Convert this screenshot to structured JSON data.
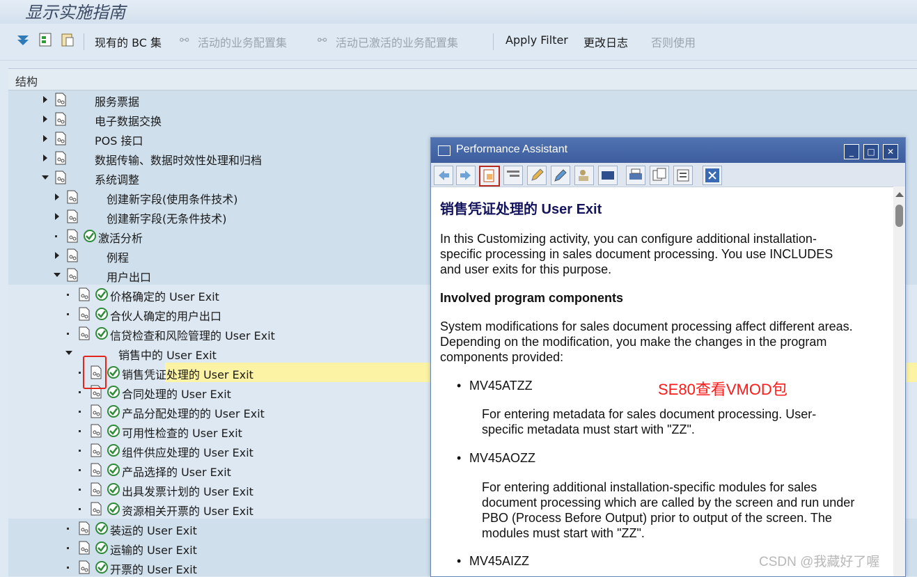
{
  "window": {
    "title": "显示实施指南"
  },
  "toolbar": {
    "items": [
      {
        "label": "现有的 BC 集",
        "enabled": true
      },
      {
        "label": "活动的业务配置集",
        "enabled": false
      },
      {
        "label": "活动已激活的业务配置集",
        "enabled": false
      },
      {
        "label": "Apply Filter",
        "enabled": true
      },
      {
        "label": "更改日志",
        "enabled": true
      },
      {
        "label": "否则使用",
        "enabled": false
      }
    ]
  },
  "tree": {
    "header": "结构",
    "nodes": [
      {
        "label": "服务票据"
      },
      {
        "label": "电子数据交换"
      },
      {
        "label": "POS 接口"
      },
      {
        "label": "数据传输、数据时效性处理和归档"
      },
      {
        "label": "系统调整"
      },
      {
        "label": "创建新字段(使用条件技术)"
      },
      {
        "label": "创建新字段(无条件技术)"
      },
      {
        "label": "激活分析"
      },
      {
        "label": "例程"
      },
      {
        "label": "用户出口"
      },
      {
        "label": "价格确定的 User Exit"
      },
      {
        "label": "合伙人确定的用户出口"
      },
      {
        "label": "信贷检查和风险管理的 User Exit"
      },
      {
        "label": "销售中的 User Exit"
      },
      {
        "label": "销售凭证处理的 User Exit"
      },
      {
        "label": "合同处理的 User Exit"
      },
      {
        "label": "产品分配处理的的 User Exit"
      },
      {
        "label": "可用性检查的 User Exit"
      },
      {
        "label": "组件供应处理的 User Exit"
      },
      {
        "label": "产品选择的 User Exit"
      },
      {
        "label": "出具发票计划的 User Exit"
      },
      {
        "label": "资源相关开票的 User Exit"
      },
      {
        "label": "装运的 User Exit"
      },
      {
        "label": "运输的 User Exit"
      },
      {
        "label": "开票的 User Exit"
      }
    ]
  },
  "assistant": {
    "title": "Performance Assistant",
    "heading": "销售凭证处理的 User Exit",
    "intro_lines": [
      "In this Customizing activity, you can configure additional installation-",
      "specific processing in sales document processing. You use INCLUDES",
      "and user exits for this purpose."
    ],
    "section_title": "Involved program components",
    "section_lines": [
      "System modifications for sales document processing affect different areas.",
      "Depending on the modification, you make the changes in the program",
      "components provided:"
    ],
    "components": [
      {
        "name": "MV45ATZZ",
        "desc_lines": [
          "For entering metadata for sales document processing. User-",
          "specific metadata must start with \"ZZ\"."
        ]
      },
      {
        "name": "MV45AOZZ",
        "desc_lines": [
          "For entering additional installation-specific modules for sales",
          "document processing which are called by the screen and run under",
          "PBO (Process Before Output) prior to output of the screen. The",
          "modules must start with \"ZZ\"."
        ]
      },
      {
        "name": "MV45AIZZ",
        "desc_lines": []
      }
    ],
    "annotation": "SE80查看VMOD包"
  },
  "watermark": "CSDN @我藏好了喔",
  "colors": {
    "accent": "#3d5d9e",
    "highlight": "#fdf3a5",
    "annotation": "#ff1a1a"
  }
}
